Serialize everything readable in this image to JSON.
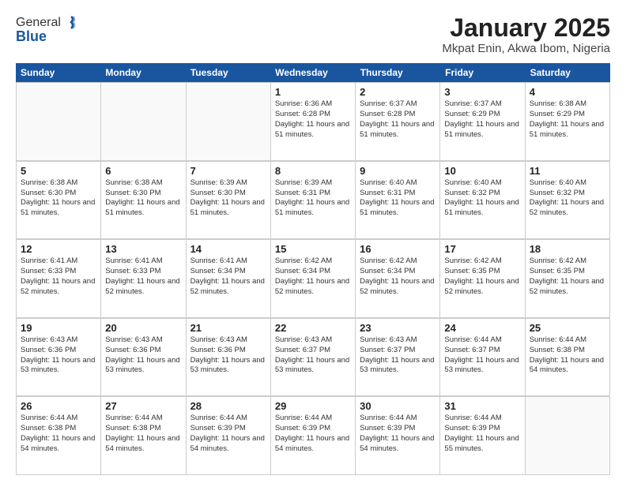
{
  "logo": {
    "general": "General",
    "blue": "Blue"
  },
  "title": "January 2025",
  "subtitle": "Mkpat Enin, Akwa Ibom, Nigeria",
  "header_days": [
    "Sunday",
    "Monday",
    "Tuesday",
    "Wednesday",
    "Thursday",
    "Friday",
    "Saturday"
  ],
  "weeks": [
    [
      {
        "day": "",
        "sunrise": "",
        "sunset": "",
        "daylight": ""
      },
      {
        "day": "",
        "sunrise": "",
        "sunset": "",
        "daylight": ""
      },
      {
        "day": "",
        "sunrise": "",
        "sunset": "",
        "daylight": ""
      },
      {
        "day": "1",
        "sunrise": "Sunrise: 6:36 AM",
        "sunset": "Sunset: 6:28 PM",
        "daylight": "Daylight: 11 hours and 51 minutes."
      },
      {
        "day": "2",
        "sunrise": "Sunrise: 6:37 AM",
        "sunset": "Sunset: 6:28 PM",
        "daylight": "Daylight: 11 hours and 51 minutes."
      },
      {
        "day": "3",
        "sunrise": "Sunrise: 6:37 AM",
        "sunset": "Sunset: 6:29 PM",
        "daylight": "Daylight: 11 hours and 51 minutes."
      },
      {
        "day": "4",
        "sunrise": "Sunrise: 6:38 AM",
        "sunset": "Sunset: 6:29 PM",
        "daylight": "Daylight: 11 hours and 51 minutes."
      }
    ],
    [
      {
        "day": "5",
        "sunrise": "Sunrise: 6:38 AM",
        "sunset": "Sunset: 6:30 PM",
        "daylight": "Daylight: 11 hours and 51 minutes."
      },
      {
        "day": "6",
        "sunrise": "Sunrise: 6:38 AM",
        "sunset": "Sunset: 6:30 PM",
        "daylight": "Daylight: 11 hours and 51 minutes."
      },
      {
        "day": "7",
        "sunrise": "Sunrise: 6:39 AM",
        "sunset": "Sunset: 6:30 PM",
        "daylight": "Daylight: 11 hours and 51 minutes."
      },
      {
        "day": "8",
        "sunrise": "Sunrise: 6:39 AM",
        "sunset": "Sunset: 6:31 PM",
        "daylight": "Daylight: 11 hours and 51 minutes."
      },
      {
        "day": "9",
        "sunrise": "Sunrise: 6:40 AM",
        "sunset": "Sunset: 6:31 PM",
        "daylight": "Daylight: 11 hours and 51 minutes."
      },
      {
        "day": "10",
        "sunrise": "Sunrise: 6:40 AM",
        "sunset": "Sunset: 6:32 PM",
        "daylight": "Daylight: 11 hours and 51 minutes."
      },
      {
        "day": "11",
        "sunrise": "Sunrise: 6:40 AM",
        "sunset": "Sunset: 6:32 PM",
        "daylight": "Daylight: 11 hours and 52 minutes."
      }
    ],
    [
      {
        "day": "12",
        "sunrise": "Sunrise: 6:41 AM",
        "sunset": "Sunset: 6:33 PM",
        "daylight": "Daylight: 11 hours and 52 minutes."
      },
      {
        "day": "13",
        "sunrise": "Sunrise: 6:41 AM",
        "sunset": "Sunset: 6:33 PM",
        "daylight": "Daylight: 11 hours and 52 minutes."
      },
      {
        "day": "14",
        "sunrise": "Sunrise: 6:41 AM",
        "sunset": "Sunset: 6:34 PM",
        "daylight": "Daylight: 11 hours and 52 minutes."
      },
      {
        "day": "15",
        "sunrise": "Sunrise: 6:42 AM",
        "sunset": "Sunset: 6:34 PM",
        "daylight": "Daylight: 11 hours and 52 minutes."
      },
      {
        "day": "16",
        "sunrise": "Sunrise: 6:42 AM",
        "sunset": "Sunset: 6:34 PM",
        "daylight": "Daylight: 11 hours and 52 minutes."
      },
      {
        "day": "17",
        "sunrise": "Sunrise: 6:42 AM",
        "sunset": "Sunset: 6:35 PM",
        "daylight": "Daylight: 11 hours and 52 minutes."
      },
      {
        "day": "18",
        "sunrise": "Sunrise: 6:42 AM",
        "sunset": "Sunset: 6:35 PM",
        "daylight": "Daylight: 11 hours and 52 minutes."
      }
    ],
    [
      {
        "day": "19",
        "sunrise": "Sunrise: 6:43 AM",
        "sunset": "Sunset: 6:36 PM",
        "daylight": "Daylight: 11 hours and 53 minutes."
      },
      {
        "day": "20",
        "sunrise": "Sunrise: 6:43 AM",
        "sunset": "Sunset: 6:36 PM",
        "daylight": "Daylight: 11 hours and 53 minutes."
      },
      {
        "day": "21",
        "sunrise": "Sunrise: 6:43 AM",
        "sunset": "Sunset: 6:36 PM",
        "daylight": "Daylight: 11 hours and 53 minutes."
      },
      {
        "day": "22",
        "sunrise": "Sunrise: 6:43 AM",
        "sunset": "Sunset: 6:37 PM",
        "daylight": "Daylight: 11 hours and 53 minutes."
      },
      {
        "day": "23",
        "sunrise": "Sunrise: 6:43 AM",
        "sunset": "Sunset: 6:37 PM",
        "daylight": "Daylight: 11 hours and 53 minutes."
      },
      {
        "day": "24",
        "sunrise": "Sunrise: 6:44 AM",
        "sunset": "Sunset: 6:37 PM",
        "daylight": "Daylight: 11 hours and 53 minutes."
      },
      {
        "day": "25",
        "sunrise": "Sunrise: 6:44 AM",
        "sunset": "Sunset: 6:38 PM",
        "daylight": "Daylight: 11 hours and 54 minutes."
      }
    ],
    [
      {
        "day": "26",
        "sunrise": "Sunrise: 6:44 AM",
        "sunset": "Sunset: 6:38 PM",
        "daylight": "Daylight: 11 hours and 54 minutes."
      },
      {
        "day": "27",
        "sunrise": "Sunrise: 6:44 AM",
        "sunset": "Sunset: 6:38 PM",
        "daylight": "Daylight: 11 hours and 54 minutes."
      },
      {
        "day": "28",
        "sunrise": "Sunrise: 6:44 AM",
        "sunset": "Sunset: 6:39 PM",
        "daylight": "Daylight: 11 hours and 54 minutes."
      },
      {
        "day": "29",
        "sunrise": "Sunrise: 6:44 AM",
        "sunset": "Sunset: 6:39 PM",
        "daylight": "Daylight: 11 hours and 54 minutes."
      },
      {
        "day": "30",
        "sunrise": "Sunrise: 6:44 AM",
        "sunset": "Sunset: 6:39 PM",
        "daylight": "Daylight: 11 hours and 54 minutes."
      },
      {
        "day": "31",
        "sunrise": "Sunrise: 6:44 AM",
        "sunset": "Sunset: 6:39 PM",
        "daylight": "Daylight: 11 hours and 55 minutes."
      },
      {
        "day": "",
        "sunrise": "",
        "sunset": "",
        "daylight": ""
      }
    ]
  ]
}
